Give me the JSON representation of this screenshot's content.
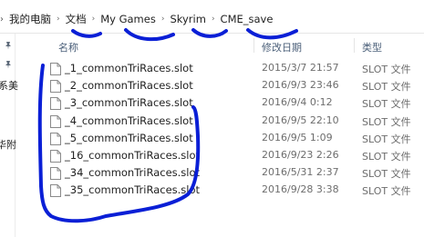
{
  "breadcrumb": {
    "items": [
      "我的电脑",
      "文档",
      "My Games",
      "Skyrim",
      "CME_save"
    ],
    "separator": "›"
  },
  "nav_pane": {
    "fragments": [
      "系美",
      "华附"
    ]
  },
  "columns": {
    "name": "名称",
    "date": "修改日期",
    "type": "类型"
  },
  "files": [
    {
      "name": "_1_commonTriRaces.slot",
      "date": "2015/3/7 21:57",
      "type": "SLOT 文件"
    },
    {
      "name": "_2_commonTriRaces.slot",
      "date": "2016/9/3 23:46",
      "type": "SLOT 文件"
    },
    {
      "name": "_3_commonTriRaces.slot",
      "date": "2016/9/4 0:12",
      "type": "SLOT 文件"
    },
    {
      "name": "_4_commonTriRaces.slot",
      "date": "2016/9/5 22:10",
      "type": "SLOT 文件"
    },
    {
      "name": "_5_commonTriRaces.slot",
      "date": "2016/9/5 1:09",
      "type": "SLOT 文件"
    },
    {
      "name": "_16_commonTriRaces.slot",
      "date": "2016/9/23 2:26",
      "type": "SLOT 文件"
    },
    {
      "name": "_34_commonTriRaces.slot",
      "date": "2016/5/31 2:37",
      "type": "SLOT 文件"
    },
    {
      "name": "_35_commonTriRaces.slot",
      "date": "2016/9/28 3:38",
      "type": "SLOT 文件"
    }
  ],
  "colors": {
    "annotation_ink": "#0a1fd6",
    "header_text": "#4c607a",
    "muted_text": "#6d6d6d"
  },
  "icons": [
    "chevron-right-icon",
    "pin-icon",
    "file-icon"
  ]
}
